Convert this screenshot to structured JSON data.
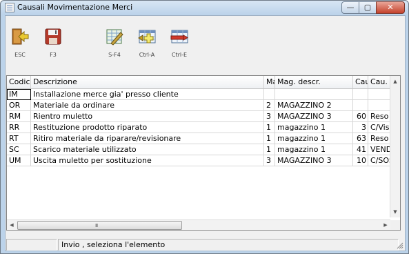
{
  "window": {
    "title": "Causali Movimentazione Merci"
  },
  "toolbar": {
    "buttons": [
      {
        "id": "esc",
        "label": "ESC",
        "icon": "exit-door-icon"
      },
      {
        "id": "f3",
        "label": "F3",
        "icon": "save-floppy-icon"
      },
      {
        "id": "sf4",
        "label": "S-F4",
        "icon": "edit-grid-icon"
      },
      {
        "id": "ctrla",
        "label": "Ctrl-A",
        "icon": "add-row-icon"
      },
      {
        "id": "ctrle",
        "label": "Ctrl-E",
        "icon": "delete-row-icon"
      }
    ]
  },
  "grid": {
    "columns": [
      "Codice",
      "Descrizione",
      "Ma",
      "Mag. descr.",
      "Caus",
      "Cau. d"
    ],
    "rows": [
      {
        "codice": "IM",
        "descrizione": "Installazione merce gia' presso cliente",
        "mag": "",
        "mag_descr": "",
        "caus": "",
        "cau_d": ""
      },
      {
        "codice": "OR",
        "descrizione": "Materiale da ordinare",
        "mag": "2",
        "mag_descr": "MAGAZZINO 2",
        "caus": "",
        "cau_d": ""
      },
      {
        "codice": "RM",
        "descrizione": "Rientro muletto",
        "mag": "3",
        "mag_descr": "MAGAZZINO 3",
        "caus": "60",
        "cau_d": "Reso C"
      },
      {
        "codice": "RR",
        "descrizione": "Restituzione prodotto riparato",
        "mag": "1",
        "mag_descr": "magazzino 1",
        "caus": "3",
        "cau_d": "C/Visio"
      },
      {
        "codice": "RT",
        "descrizione": "Ritiro materiale da riparare/revisionare",
        "mag": "1",
        "mag_descr": "magazzino 1",
        "caus": "63",
        "cau_d": "Reso C"
      },
      {
        "codice": "SC",
        "descrizione": "Scarico materiale utilizzato",
        "mag": "1",
        "mag_descr": "magazzino 1",
        "caus": "41",
        "cau_d": "VENDI"
      },
      {
        "codice": "UM",
        "descrizione": "Uscita muletto per sostituzione",
        "mag": "3",
        "mag_descr": "MAGAZZINO 3",
        "caus": "10",
        "cau_d": "C/SOS"
      }
    ],
    "scroll_grip": "III"
  },
  "statusbar": {
    "pane1": "",
    "message": "Invio , seleziona l'elemento"
  }
}
